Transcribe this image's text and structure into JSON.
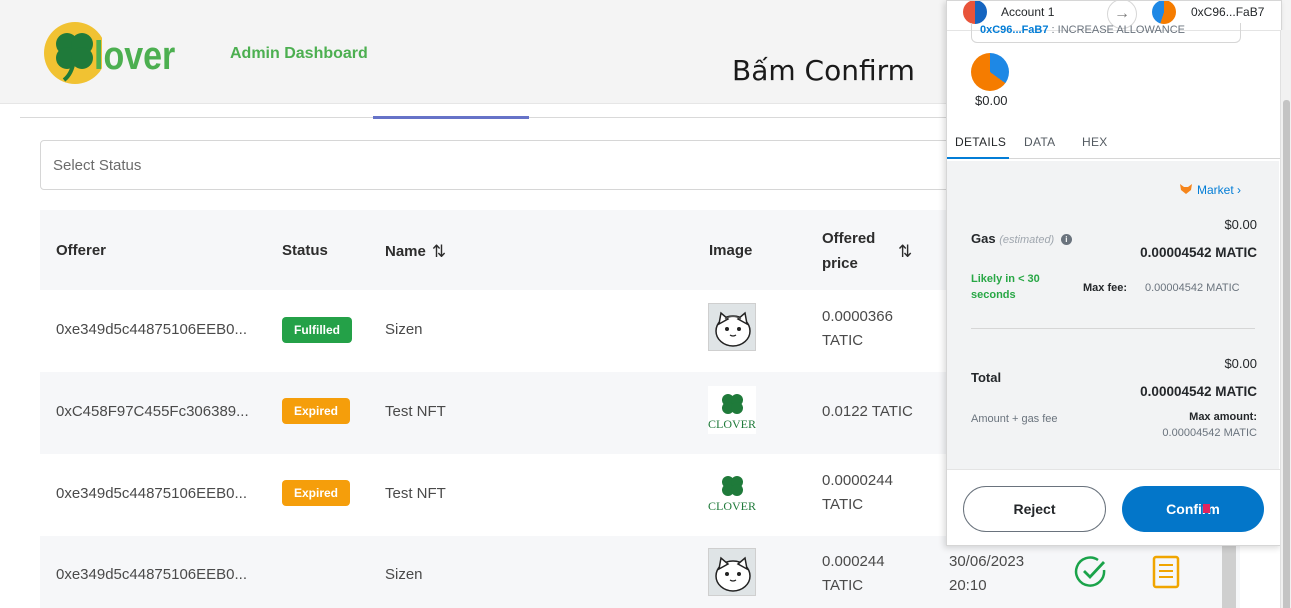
{
  "header": {
    "logo_text": "lover",
    "title": "Admin Dashboard",
    "caption": "Bấm Confirm"
  },
  "filter": {
    "select_placeholder": "Select Status"
  },
  "table": {
    "headers": {
      "offerer": "Offerer",
      "status": "Status",
      "name": "Name",
      "image": "Image",
      "offered_price_line1": "Offered",
      "offered_price_line2": "price"
    },
    "rows": [
      {
        "offerer": "0xe349d5c44875106EEB0...",
        "status": "Fulfilled",
        "name": "Sizen",
        "image": "cat",
        "price_line1": "0.0000366",
        "price_line2": "TATIC",
        "date": "",
        "time": ""
      },
      {
        "offerer": "0xC458F97C455Fc306389...",
        "status": "Expired",
        "name": "Test NFT",
        "image": "clover",
        "price_line1": "0.0122 TATIC",
        "price_line2": "",
        "date": "",
        "time": ""
      },
      {
        "offerer": "0xe349d5c44875106EEB0...",
        "status": "Expired",
        "name": "Test NFT",
        "image": "clover",
        "price_line1": "0.0000244",
        "price_line2": "TATIC",
        "date": "",
        "time": ""
      },
      {
        "offerer": "0xe349d5c44875106EEB0...",
        "status": "",
        "name": "Sizen",
        "image": "cat",
        "price_line1": "0.000244",
        "price_line2": "TATIC",
        "date": "30/06/2023",
        "time": "20:10"
      }
    ]
  },
  "metamask": {
    "from_account": "Account 1",
    "to_account": "0xC96...FaB7",
    "allowance_addr": "0xC96...FaB7",
    "allowance_text": " : INCREASE ALLOWANCE",
    "amount": "$0.00",
    "tabs": [
      "DETAILS",
      "DATA",
      "HEX"
    ],
    "market_link": "Market",
    "gas_label": "Gas",
    "gas_estimated": "(estimated)",
    "gas_fiat": "$0.00",
    "gas_amount": "0.00004542 MATIC",
    "likely": "Likely in < 30 seconds",
    "max_fee_label": "Max fee:",
    "max_fee_value": "0.00004542 MATIC",
    "total_label": "Total",
    "total_fiat": "$0.00",
    "total_amount": "0.00004542 MATIC",
    "amount_gas_label": "Amount + gas fee",
    "max_amount_label": "Max amount:",
    "max_amount_value": "0.00004542 MATIC",
    "reject_label": "Reject",
    "confirm_label": "Confirm"
  },
  "colors": {
    "brand_green": "#4caf50",
    "badge_fulfilled": "#24a148",
    "badge_expired": "#f59e0b",
    "metamask_blue": "#037dd6"
  }
}
